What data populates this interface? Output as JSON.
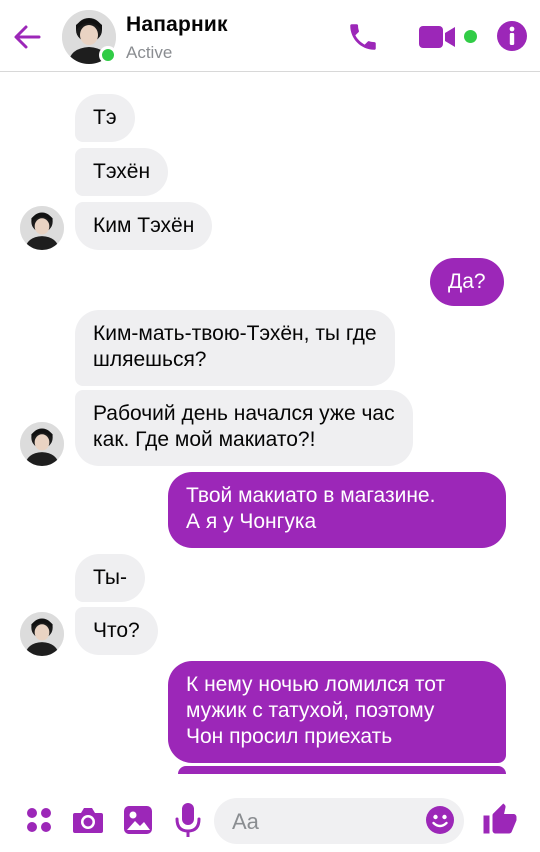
{
  "header": {
    "name": "Напарник",
    "status": "Active"
  },
  "icons": {
    "back": "arrow-left-icon",
    "phone": "phone-icon",
    "video": "video-camera-icon",
    "info": "info-icon",
    "apps": "apps-grid-icon",
    "camera": "camera-icon",
    "gallery": "image-icon",
    "mic": "microphone-icon",
    "emoji": "emoji-icon",
    "like": "thumbs-up-icon"
  },
  "colors": {
    "accent": "#9c27b8",
    "incoming_bubble": "#efeff1",
    "online": "#31cc46"
  },
  "messages": [
    {
      "id": "m1",
      "side": "in",
      "text": "Тэ"
    },
    {
      "id": "m2",
      "side": "in",
      "text": "Тэхён"
    },
    {
      "id": "m3",
      "side": "in",
      "text": "Ким Тэхён"
    },
    {
      "id": "m4",
      "side": "out",
      "text": "Да?"
    },
    {
      "id": "m5",
      "side": "in",
      "lines": [
        "Ким-мать-твою-Тэхён, ты где",
        "шляешься?"
      ]
    },
    {
      "id": "m6",
      "side": "in",
      "lines": [
        "Рабочий день начался уже час",
        "как. Где мой макиато?!"
      ]
    },
    {
      "id": "m7",
      "side": "out",
      "lines": [
        "Твой макиато в магазине.",
        "А я у Чонгука"
      ]
    },
    {
      "id": "m8",
      "side": "in",
      "text": "Ты-"
    },
    {
      "id": "m9",
      "side": "in",
      "text": "Что?"
    },
    {
      "id": "m10",
      "side": "out",
      "lines": [
        "К нему ночью ломился тот",
        "мужик с татухой, поэтому",
        "Чон просил приехать"
      ]
    }
  ],
  "composer": {
    "placeholder": "Aa"
  }
}
